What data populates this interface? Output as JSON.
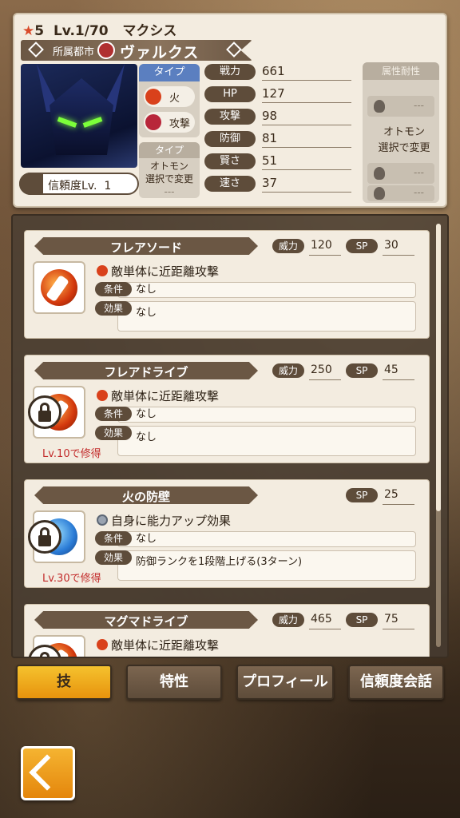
{
  "header": {
    "rarity": "5",
    "level": "Lv.1/70",
    "name": "マクシス",
    "city_label": "所属都市",
    "city_name": "ヴァルクス",
    "trust_label": "信頼度Lv.",
    "trust_level": "1"
  },
  "type": {
    "head": "タイプ",
    "element": "火",
    "role": "攻撃",
    "otomon_head": "タイプ",
    "otomon_text_1": "オトモン",
    "otomon_text_2": "選択で変更",
    "otomon_dash": "---"
  },
  "stats": [
    {
      "label": "戦力",
      "value": "661"
    },
    {
      "label": "HP",
      "value": "127"
    },
    {
      "label": "攻撃",
      "value": "98"
    },
    {
      "label": "防御",
      "value": "81"
    },
    {
      "label": "賢さ",
      "value": "51"
    },
    {
      "label": "速さ",
      "value": "37"
    }
  ],
  "resist": {
    "head": "属性耐性",
    "dash": "---",
    "overlay_1": "オトモン",
    "overlay_2": "選択で変更"
  },
  "skills": [
    {
      "name": "フレアソード",
      "power_label": "威力",
      "power": "120",
      "sp_label": "SP",
      "sp": "30",
      "desc": "敵単体に近距離攻撃",
      "cond_label": "条件",
      "cond": "なし",
      "effect_label": "効果",
      "effect": "なし",
      "learn": ""
    },
    {
      "name": "フレアドライブ",
      "power_label": "威力",
      "power": "250",
      "sp_label": "SP",
      "sp": "45",
      "desc": "敵単体に近距離攻撃",
      "cond_label": "条件",
      "cond": "なし",
      "effect_label": "効果",
      "effect": "なし",
      "learn": "Lv.10で修得"
    },
    {
      "name": "火の防壁",
      "power_label": "",
      "power": "",
      "sp_label": "SP",
      "sp": "25",
      "desc": "自身に能力アップ効果",
      "cond_label": "条件",
      "cond": "なし",
      "effect_label": "効果",
      "effect": "防御ランクを1段階上げる(3ターン)",
      "learn": "Lv.30で修得"
    },
    {
      "name": "マグマドライブ",
      "power_label": "威力",
      "power": "465",
      "sp_label": "SP",
      "sp": "75",
      "desc": "敵単体に近距離攻撃",
      "cond_label": "",
      "cond": "",
      "effect_label": "",
      "effect": "",
      "learn": ""
    }
  ],
  "tabs": [
    "技",
    "特性",
    "プロフィール",
    "信頼度会話"
  ]
}
